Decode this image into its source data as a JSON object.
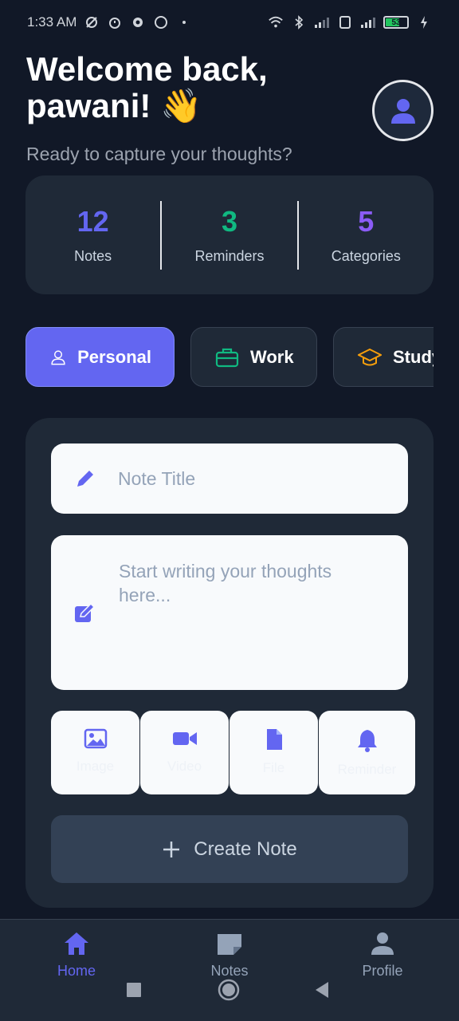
{
  "status_bar": {
    "time": "1:33 AM",
    "battery": "53",
    "left_icons": [
      "mute-icon",
      "alarm-icon",
      "settings-icon",
      "whatsapp-icon",
      "dot-icon"
    ],
    "right_icons": [
      "wifi-icon",
      "bluetooth-icon",
      "signal-icon",
      "sim-icon",
      "signal-icon",
      "charging-icon"
    ]
  },
  "header": {
    "welcome_line1": "Welcome back,",
    "welcome_line2": "pawani! 👋",
    "subtitle": "Ready to capture your thoughts?"
  },
  "stats": [
    {
      "value": "12",
      "label": "Notes",
      "color": "#6366f1"
    },
    {
      "value": "3",
      "label": "Reminders",
      "color": "#10b981"
    },
    {
      "value": "5",
      "label": "Categories",
      "color": "#8b5cf6"
    }
  ],
  "categories": [
    {
      "label": "Personal",
      "icon": "person-icon",
      "active": true
    },
    {
      "label": "Work",
      "icon": "briefcase-icon",
      "active": false
    },
    {
      "label": "Study",
      "icon": "graduation-cap-icon",
      "active": false
    }
  ],
  "editor": {
    "title_placeholder": "Note Title",
    "body_placeholder": "Start writing your thoughts here...",
    "attachments": [
      {
        "label": "Image",
        "icon": "image-icon"
      },
      {
        "label": "Video",
        "icon": "video-icon"
      },
      {
        "label": "File",
        "icon": "file-icon"
      },
      {
        "label": "Reminder",
        "icon": "bell-icon"
      }
    ],
    "create_label": "Create Note"
  },
  "bottom_nav": [
    {
      "label": "Home",
      "icon": "home-icon",
      "active": true
    },
    {
      "label": "Notes",
      "icon": "note-icon",
      "active": false
    },
    {
      "label": "Profile",
      "icon": "person-icon",
      "active": false
    }
  ],
  "colors": {
    "background": "#111827",
    "card": "#1f2937",
    "accent": "#6366f1",
    "work": "#10b981",
    "study": "#f59e0b"
  }
}
